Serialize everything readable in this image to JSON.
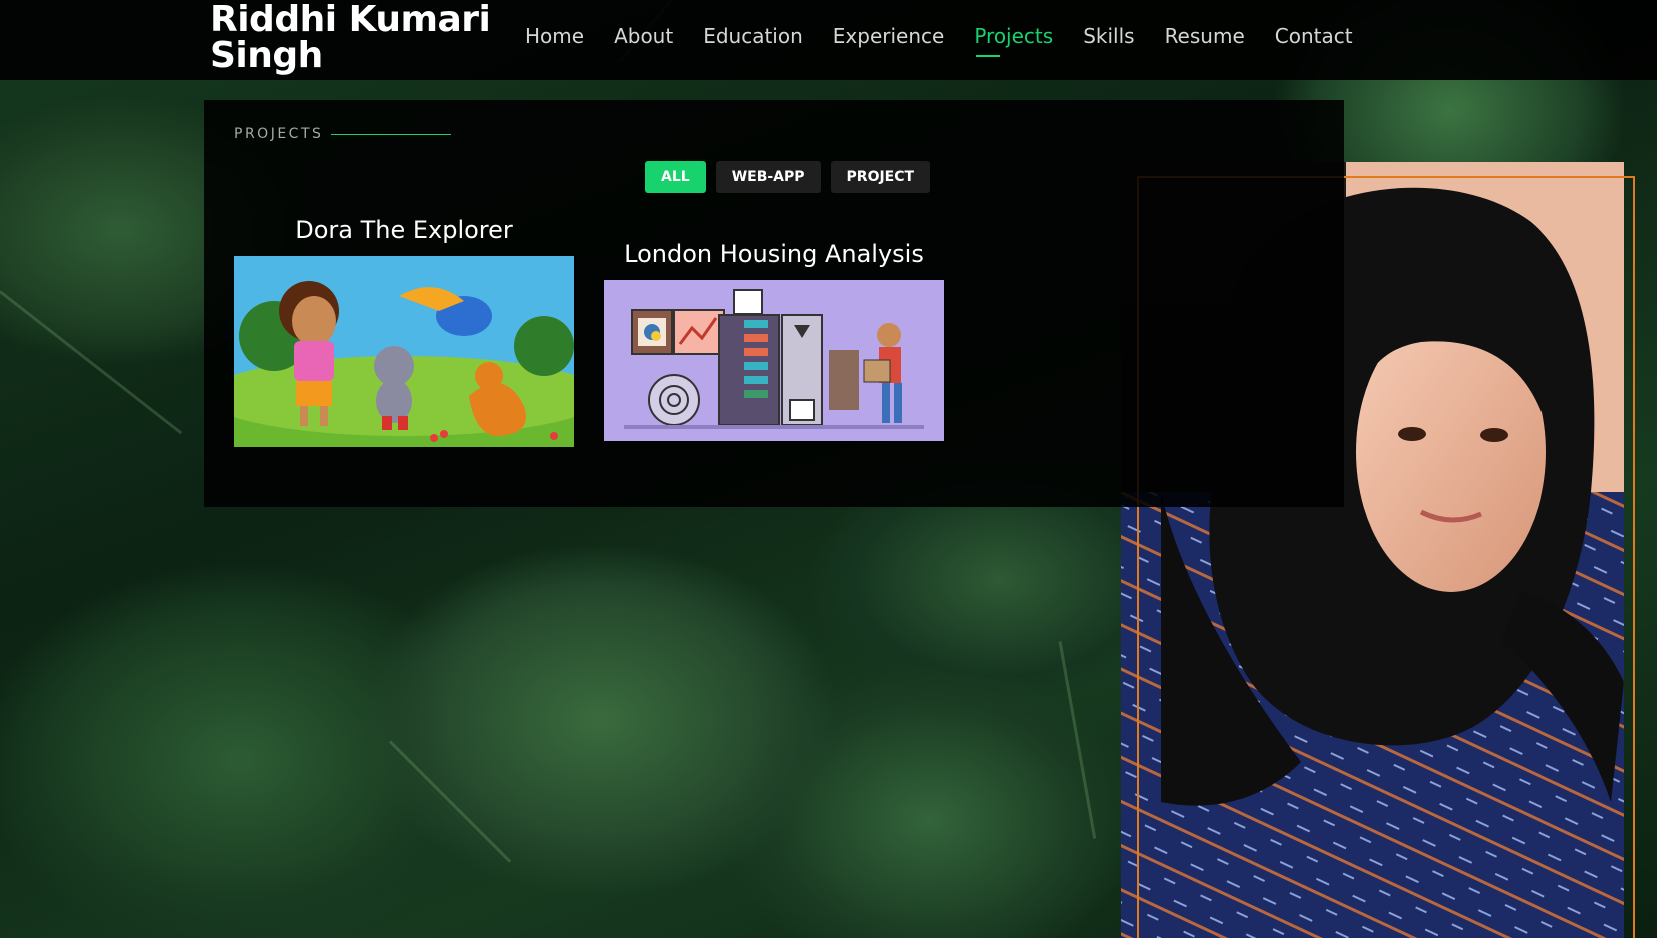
{
  "header": {
    "brand": "Riddhi Kumari Singh",
    "nav": [
      {
        "label": "Home",
        "active": false
      },
      {
        "label": "About",
        "active": false
      },
      {
        "label": "Education",
        "active": false
      },
      {
        "label": "Experience",
        "active": false
      },
      {
        "label": "Projects",
        "active": true
      },
      {
        "label": "Skills",
        "active": false
      },
      {
        "label": "Resume",
        "active": false
      },
      {
        "label": "Contact",
        "active": false
      }
    ]
  },
  "projects": {
    "section_label": "PROJECTS",
    "filters": [
      {
        "label": "ALL",
        "active": true
      },
      {
        "label": "WEB-APP",
        "active": false
      },
      {
        "label": "PROJECT",
        "active": false
      }
    ],
    "items": [
      {
        "title": "Dora The Explorer",
        "thumb_icon": "dora-cartoon-image"
      },
      {
        "title": "London Housing Analysis",
        "thumb_icon": "data-analysis-illustration"
      }
    ]
  },
  "colors": {
    "accent": "#18d26e",
    "frame": "#e07b1e"
  }
}
